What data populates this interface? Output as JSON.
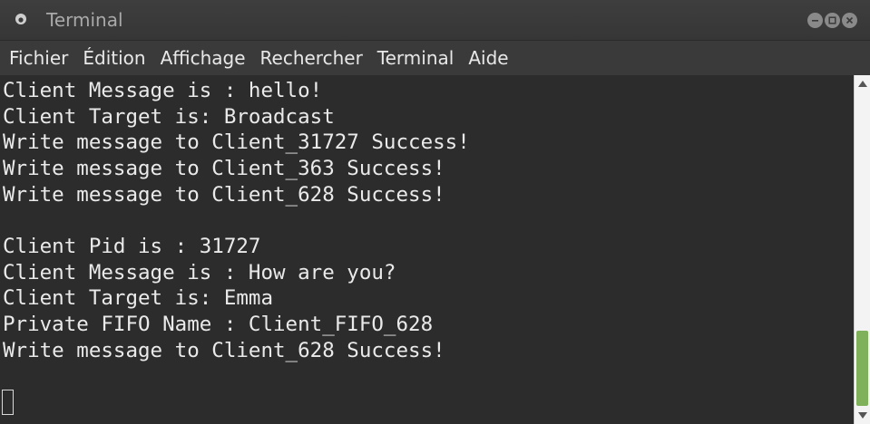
{
  "window": {
    "title": "Terminal",
    "app_icon": "terminal-app-icon",
    "controls": [
      "minimize-icon",
      "maximize-icon",
      "close-icon"
    ]
  },
  "menu": {
    "items": [
      "Fichier",
      "Édition",
      "Affichage",
      "Rechercher",
      "Terminal",
      "Aide"
    ]
  },
  "terminal": {
    "lines": [
      "Client Message is : hello!",
      "Client Target is: Broadcast",
      "Write message to Client_31727 Success!",
      "Write message to Client_363 Success!",
      "Write message to Client_628 Success!",
      "",
      "Client Pid is : 31727",
      "Client Message is : How are you?",
      "Client Target is: Emma",
      "Private FIFO Name : Client_FIFO_628",
      "Write message to Client_628 Success!"
    ],
    "foreground": "#eaeaea",
    "background": "#2c2c2c"
  },
  "scrollbar": {
    "position_fraction": 0.76,
    "visible_fraction": 0.24,
    "thumb_color": "#7fb05a"
  }
}
